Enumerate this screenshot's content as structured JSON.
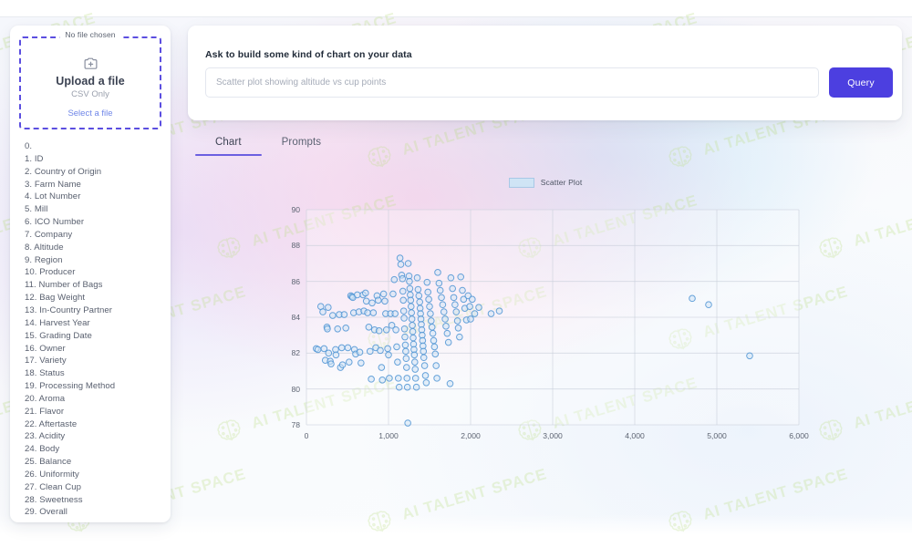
{
  "sidebar": {
    "upload": {
      "no_file_label": "No file chosen",
      "icon": "add-file-icon",
      "title": "Upload a file",
      "subtitle": "CSV Only",
      "select_link": "Select a file"
    },
    "columns": [
      "0.",
      "1. ID",
      "2. Country of Origin",
      "3. Farm Name",
      "4. Lot Number",
      "5. Mill",
      "6. ICO Number",
      "7. Company",
      "8. Altitude",
      "9. Region",
      "10. Producer",
      "11. Number of Bags",
      "12. Bag Weight",
      "13. In-Country Partner",
      "14. Harvest Year",
      "15. Grading Date",
      "16. Owner",
      "17. Variety",
      "18. Status",
      "19. Processing Method",
      "20. Aroma",
      "21. Flavor",
      "22. Aftertaste",
      "23. Acidity",
      "24. Body",
      "25. Balance",
      "26. Uniformity",
      "27. Clean Cup",
      "28. Sweetness",
      "29. Overall"
    ]
  },
  "query": {
    "label": "Ask to build some kind of chart on your data",
    "input_value": "",
    "placeholder": "Scatter plot showing altitude vs cup points",
    "button_label": "Query",
    "button_color": "#4c3fe0"
  },
  "tabs": [
    {
      "label": "Chart",
      "active": true
    },
    {
      "label": "Prompts",
      "active": false
    }
  ],
  "watermark": {
    "text": "AI TALENT SPACE",
    "icon": "brain-icon",
    "color": "#bfe08a"
  },
  "chart_data": {
    "type": "scatter",
    "title": "",
    "xlabel": "",
    "ylabel": "",
    "xlim": [
      0,
      6000
    ],
    "ylim": [
      78,
      90
    ],
    "xticks": [
      0,
      1000,
      2000,
      3000,
      4000,
      5000,
      6000
    ],
    "xtick_labels": [
      "0",
      "1,000",
      "2,000",
      "3,000",
      "4,000",
      "5,000",
      "6,000"
    ],
    "yticks": [
      78,
      80,
      82,
      84,
      86,
      88,
      90
    ],
    "ytick_labels": [
      "78",
      "80",
      "82",
      "84",
      "86",
      "88",
      "90"
    ],
    "grid": true,
    "legend": {
      "position": "top-center",
      "entries": [
        "Scatter Plot"
      ]
    },
    "marker": {
      "shape": "circle",
      "radius": 3.3,
      "fill": "#cfe4f5",
      "fill_opacity": 0.55,
      "stroke": "#4f94d4",
      "stroke_width": 1
    },
    "series": [
      {
        "name": "Scatter Plot",
        "points": [
          [
            120,
            82.25
          ],
          [
            140,
            82.2
          ],
          [
            175,
            84.6
          ],
          [
            200,
            84.3
          ],
          [
            215,
            82.25
          ],
          [
            230,
            81.6
          ],
          [
            250,
            83.45
          ],
          [
            255,
            83.35
          ],
          [
            265,
            84.55
          ],
          [
            270,
            82.0
          ],
          [
            290,
            81.55
          ],
          [
            300,
            81.4
          ],
          [
            320,
            84.1
          ],
          [
            355,
            82.2
          ],
          [
            360,
            81.9
          ],
          [
            380,
            83.35
          ],
          [
            400,
            84.15
          ],
          [
            415,
            81.2
          ],
          [
            430,
            82.3
          ],
          [
            440,
            81.35
          ],
          [
            460,
            84.15
          ],
          [
            480,
            83.4
          ],
          [
            505,
            82.3
          ],
          [
            520,
            81.5
          ],
          [
            540,
            85.2
          ],
          [
            555,
            85.15
          ],
          [
            565,
            85.1
          ],
          [
            575,
            84.25
          ],
          [
            585,
            82.2
          ],
          [
            600,
            81.95
          ],
          [
            620,
            85.25
          ],
          [
            640,
            84.3
          ],
          [
            650,
            82.05
          ],
          [
            665,
            81.45
          ],
          [
            690,
            85.25
          ],
          [
            700,
            84.35
          ],
          [
            720,
            85.35
          ],
          [
            730,
            84.9
          ],
          [
            745,
            84.25
          ],
          [
            760,
            83.45
          ],
          [
            775,
            82.1
          ],
          [
            790,
            80.55
          ],
          [
            800,
            84.8
          ],
          [
            815,
            84.25
          ],
          [
            830,
            83.3
          ],
          [
            845,
            82.3
          ],
          [
            860,
            85.2
          ],
          [
            875,
            84.95
          ],
          [
            885,
            83.25
          ],
          [
            900,
            82.15
          ],
          [
            915,
            81.2
          ],
          [
            925,
            80.5
          ],
          [
            940,
            85.3
          ],
          [
            955,
            84.9
          ],
          [
            965,
            84.2
          ],
          [
            975,
            83.3
          ],
          [
            990,
            82.25
          ],
          [
            1000,
            81.9
          ],
          [
            1010,
            80.6
          ],
          [
            1025,
            84.2
          ],
          [
            1040,
            83.55
          ],
          [
            1055,
            85.3
          ],
          [
            1070,
            86.1
          ],
          [
            1080,
            84.2
          ],
          [
            1090,
            83.3
          ],
          [
            1100,
            82.35
          ],
          [
            1110,
            81.5
          ],
          [
            1120,
            80.6
          ],
          [
            1130,
            80.1
          ],
          [
            1140,
            87.3
          ],
          [
            1150,
            86.95
          ],
          [
            1160,
            86.35
          ],
          [
            1170,
            86.15
          ],
          [
            1175,
            85.45
          ],
          [
            1180,
            84.95
          ],
          [
            1185,
            84.35
          ],
          [
            1190,
            83.95
          ],
          [
            1195,
            83.35
          ],
          [
            1200,
            82.9
          ],
          [
            1205,
            82.45
          ],
          [
            1210,
            82.1
          ],
          [
            1215,
            81.7
          ],
          [
            1220,
            81.2
          ],
          [
            1225,
            80.6
          ],
          [
            1230,
            80.1
          ],
          [
            1235,
            78.1
          ],
          [
            1240,
            87.0
          ],
          [
            1250,
            86.3
          ],
          [
            1255,
            86.0
          ],
          [
            1260,
            85.6
          ],
          [
            1265,
            85.25
          ],
          [
            1270,
            84.95
          ],
          [
            1275,
            84.6
          ],
          [
            1280,
            84.25
          ],
          [
            1285,
            83.9
          ],
          [
            1290,
            83.55
          ],
          [
            1295,
            83.2
          ],
          [
            1300,
            82.85
          ],
          [
            1305,
            82.5
          ],
          [
            1310,
            82.2
          ],
          [
            1315,
            81.9
          ],
          [
            1320,
            81.5
          ],
          [
            1325,
            81.1
          ],
          [
            1330,
            80.6
          ],
          [
            1340,
            80.1
          ],
          [
            1350,
            86.2
          ],
          [
            1360,
            85.55
          ],
          [
            1370,
            85.2
          ],
          [
            1380,
            84.85
          ],
          [
            1385,
            84.5
          ],
          [
            1390,
            84.2
          ],
          [
            1395,
            83.9
          ],
          [
            1400,
            83.6
          ],
          [
            1405,
            83.3
          ],
          [
            1410,
            83.0
          ],
          [
            1415,
            82.7
          ],
          [
            1420,
            82.4
          ],
          [
            1425,
            82.1
          ],
          [
            1430,
            81.75
          ],
          [
            1440,
            81.3
          ],
          [
            1450,
            80.75
          ],
          [
            1460,
            80.35
          ],
          [
            1470,
            85.95
          ],
          [
            1480,
            85.4
          ],
          [
            1490,
            85.0
          ],
          [
            1500,
            84.6
          ],
          [
            1510,
            84.2
          ],
          [
            1520,
            83.8
          ],
          [
            1530,
            83.45
          ],
          [
            1540,
            83.1
          ],
          [
            1550,
            82.7
          ],
          [
            1560,
            82.35
          ],
          [
            1570,
            81.95
          ],
          [
            1580,
            81.3
          ],
          [
            1590,
            80.6
          ],
          [
            1600,
            86.5
          ],
          [
            1615,
            85.9
          ],
          [
            1630,
            85.5
          ],
          [
            1645,
            85.1
          ],
          [
            1660,
            84.7
          ],
          [
            1675,
            84.3
          ],
          [
            1690,
            83.9
          ],
          [
            1700,
            83.5
          ],
          [
            1715,
            83.1
          ],
          [
            1730,
            82.6
          ],
          [
            1750,
            80.3
          ],
          [
            1760,
            86.2
          ],
          [
            1780,
            85.6
          ],
          [
            1795,
            85.1
          ],
          [
            1810,
            84.7
          ],
          [
            1825,
            84.3
          ],
          [
            1840,
            83.8
          ],
          [
            1850,
            83.4
          ],
          [
            1865,
            82.9
          ],
          [
            1880,
            86.25
          ],
          [
            1900,
            85.5
          ],
          [
            1915,
            85.0
          ],
          [
            1930,
            84.5
          ],
          [
            1950,
            83.85
          ],
          [
            1970,
            85.2
          ],
          [
            1990,
            84.6
          ],
          [
            2000,
            83.9
          ],
          [
            2020,
            85.0
          ],
          [
            2050,
            84.2
          ],
          [
            2100,
            84.55
          ],
          [
            2250,
            84.2
          ],
          [
            2350,
            84.35
          ],
          [
            4700,
            85.05
          ],
          [
            4900,
            84.7
          ],
          [
            5400,
            81.85
          ]
        ]
      }
    ]
  }
}
